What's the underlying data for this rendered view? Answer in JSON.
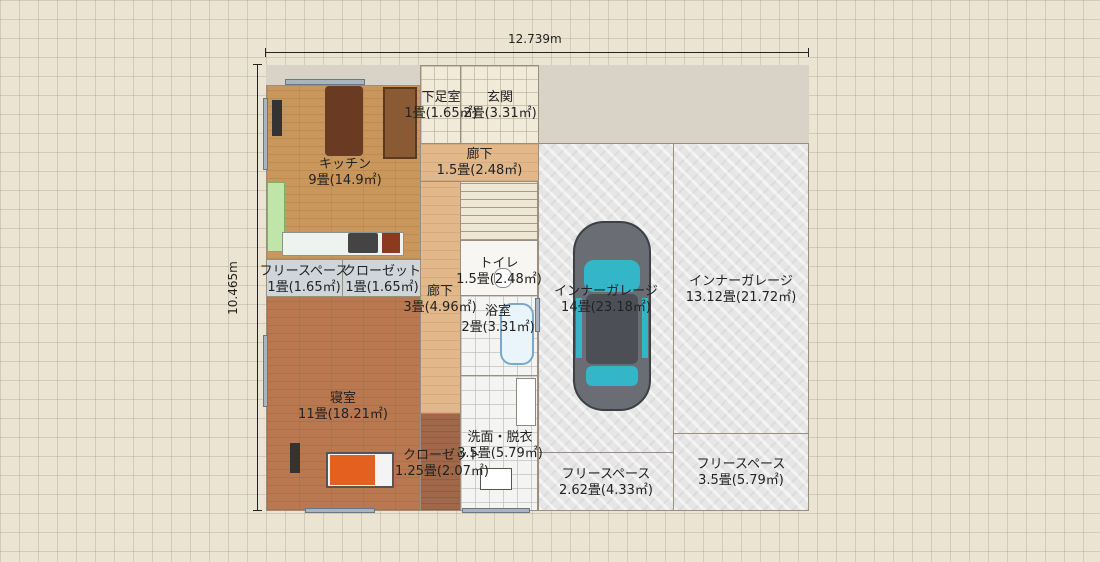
{
  "dimensions": {
    "width": "12.739m",
    "height": "10.465m"
  },
  "rooms": [
    {
      "name": "キッチン",
      "size": "9畳(14.9㎡)"
    },
    {
      "name": "下足室",
      "size": "1畳(1.65㎡)"
    },
    {
      "name": "玄関",
      "size": "2畳(3.31㎡)"
    },
    {
      "name": "廊下",
      "size": "1.5畳(2.48㎡)"
    },
    {
      "name": "フリースペース",
      "size": "1畳(1.65㎡)"
    },
    {
      "name": "クローゼット",
      "size": "1畳(1.65㎡)"
    },
    {
      "name": "トイレ",
      "size": "1.5畳(2.48㎡)"
    },
    {
      "name": "廊下",
      "size": "3畳(4.96㎡)"
    },
    {
      "name": "浴室",
      "size": "2畳(3.31㎡)"
    },
    {
      "name": "インナーガレージ",
      "size": "14畳(23.18㎡)"
    },
    {
      "name": "インナーガレージ",
      "size": "13.12畳(21.72㎡)"
    },
    {
      "name": "寝室",
      "size": "11畳(18.21㎡)"
    },
    {
      "name": "洗面・脱衣",
      "size": "3.5畳(5.79㎡)"
    },
    {
      "name": "クローゼット",
      "size": "1.25畳(2.07㎡)"
    },
    {
      "name": "フリースペース",
      "size": "2.62畳(4.33㎡)"
    },
    {
      "name": "フリースペース",
      "size": "3.5畳(5.79㎡)"
    }
  ],
  "colors": {
    "background": "#ebe4d2",
    "car_body": "#6a6e74",
    "car_glass": "#33b6c8"
  }
}
